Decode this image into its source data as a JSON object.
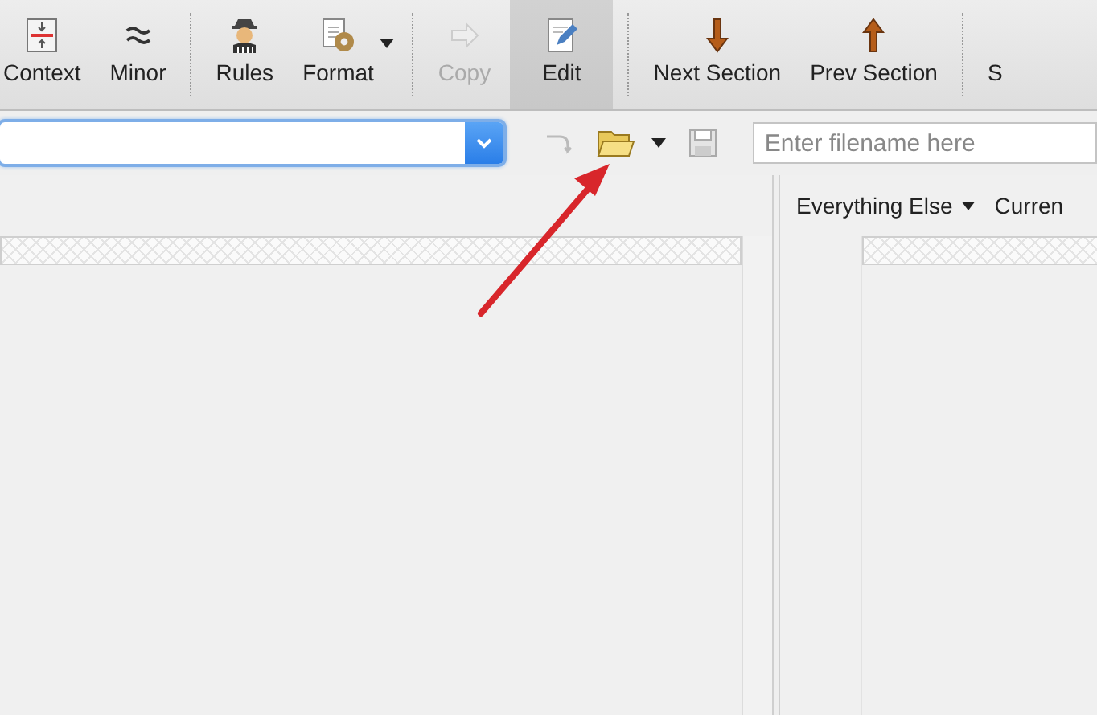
{
  "toolbar": {
    "items": [
      {
        "kind": "button",
        "label": "Context",
        "disabled": false,
        "selected": false,
        "dropdown": false
      },
      {
        "kind": "button",
        "label": "Minor",
        "disabled": false,
        "selected": false,
        "dropdown": false
      },
      {
        "kind": "separator"
      },
      {
        "kind": "button",
        "label": "Rules",
        "disabled": false,
        "selected": false,
        "dropdown": false
      },
      {
        "kind": "button",
        "label": "Format",
        "disabled": false,
        "selected": false,
        "dropdown": true
      },
      {
        "kind": "separator"
      },
      {
        "kind": "button",
        "label": "Copy",
        "disabled": true,
        "selected": false,
        "dropdown": false
      },
      {
        "kind": "button",
        "label": "Edit",
        "disabled": false,
        "selected": true,
        "dropdown": false
      },
      {
        "kind": "separator"
      },
      {
        "kind": "button",
        "label": "Next Section",
        "disabled": false,
        "selected": false,
        "dropdown": false
      },
      {
        "kind": "button",
        "label": "Prev Section",
        "disabled": false,
        "selected": false,
        "dropdown": false
      },
      {
        "kind": "separator"
      },
      {
        "kind": "button",
        "label": "S",
        "disabled": false,
        "selected": false,
        "dropdown": false
      }
    ]
  },
  "filename_field": {
    "placeholder": "Enter filename here"
  },
  "right_pane": {
    "tabs": [
      {
        "label": "Everything Else",
        "dropdown": true
      },
      {
        "label": "Curren",
        "dropdown": false
      }
    ]
  },
  "annotation": {
    "kind": "arrow"
  }
}
